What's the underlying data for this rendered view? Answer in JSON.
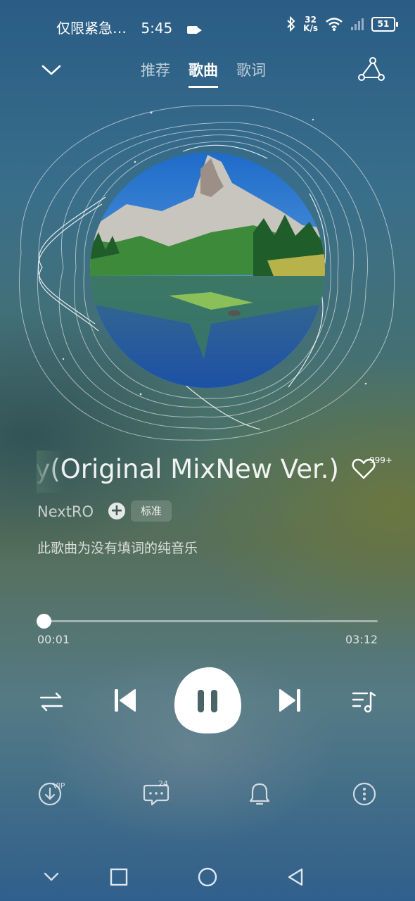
{
  "status_bar": {
    "notification_text": "仅限紧急…",
    "time": "5:45",
    "net_speed_value": "32",
    "net_speed_unit": "K/s",
    "battery": "51"
  },
  "header": {
    "tabs": [
      {
        "label": "推荐",
        "active": false
      },
      {
        "label": "歌曲",
        "active": true
      },
      {
        "label": "歌词",
        "active": false
      }
    ]
  },
  "song": {
    "title_visible": "ny(Original MixNew Ver.)",
    "like_count": "999+",
    "artist": "NextRO",
    "quality_label": "标准",
    "lyric_notice": "此歌曲为没有填词的纯音乐"
  },
  "progress": {
    "current": "00:01",
    "total": "03:12",
    "fraction": 0.005
  },
  "actions": {
    "download_badge": "VIP",
    "comment_count": "24"
  },
  "colors": {
    "accent": "#ffffff",
    "pause_icon": "#4a6468"
  }
}
